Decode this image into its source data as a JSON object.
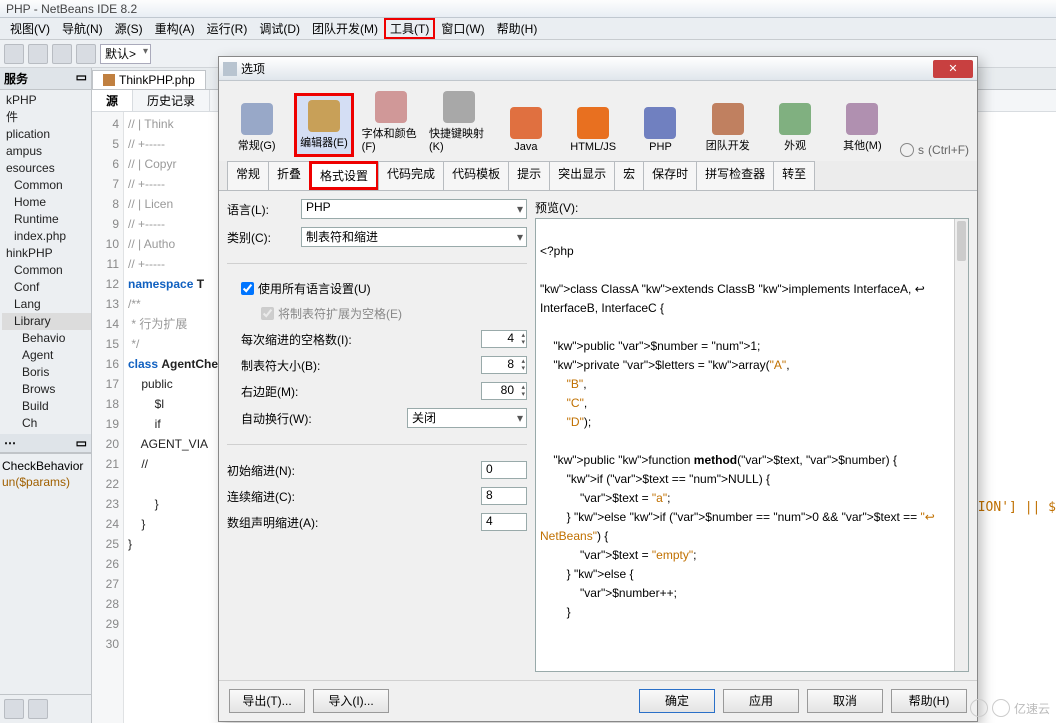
{
  "window": {
    "title": "PHP - NetBeans IDE 8.2"
  },
  "menu": [
    "视图(V)",
    "导航(N)",
    "源(S)",
    "重构(A)",
    "运行(R)",
    "调试(D)",
    "团队开发(M)",
    "工具(T)",
    "窗口(W)",
    "帮助(H)"
  ],
  "toolbar": {
    "combo": "默认>"
  },
  "services_panel": {
    "title": "服务"
  },
  "project_tree": [
    {
      "l": 1,
      "t": "kPHP"
    },
    {
      "l": 1,
      "t": "件"
    },
    {
      "l": 1,
      "t": "plication"
    },
    {
      "l": 1,
      "t": "ampus"
    },
    {
      "l": 1,
      "t": "esources"
    },
    {
      "l": 2,
      "t": "Common"
    },
    {
      "l": 2,
      "t": "Home"
    },
    {
      "l": 2,
      "t": "Runtime"
    },
    {
      "l": 2,
      "t": "index.php"
    },
    {
      "l": 1,
      "t": "hinkPHP"
    },
    {
      "l": 2,
      "t": "Common"
    },
    {
      "l": 2,
      "t": "Conf"
    },
    {
      "l": 2,
      "t": "Lang"
    },
    {
      "l": 2,
      "t": "Library",
      "sel": true
    },
    {
      "l": 3,
      "t": "Behavio"
    },
    {
      "l": 3,
      "t": "Agent"
    },
    {
      "l": 3,
      "t": "Boris"
    },
    {
      "l": 3,
      "t": "Brows"
    },
    {
      "l": 3,
      "t": "Build"
    },
    {
      "l": 3,
      "t": "Ch"
    }
  ],
  "navigator": {
    "item1": "CheckBehavior",
    "item2": "un($params)"
  },
  "editor": {
    "tab": "ThinkPHP.php",
    "sub_source": "源",
    "sub_history": "历史记录",
    "lines_start": 4,
    "lines_end": 30,
    "code_lines": [
      "// | Think",
      "// +-----",
      "// | Copyr",
      "// +-----",
      "// | Licen",
      "// +-----",
      "// | Autho",
      "// +-----",
      "",
      "namespace T",
      "",
      "/**",
      " * 行为扩展",
      " */",
      "class AgentCheckBehavior",
      "",
      "    public",
      "        $l",
      "        if",
      "    AGENT_VIA",
      "    //",
      "    ",
      "        }",
      "    }",
      "",
      "}",
      ""
    ]
  },
  "far_right_text": "TION'] || $",
  "dialog": {
    "title": "选项",
    "close": "✕",
    "search_hint": "(Ctrl+F)",
    "search_icon_text": "s",
    "categories": [
      {
        "id": "general",
        "label": "常规(G)",
        "color": "#98a8c8"
      },
      {
        "id": "editor",
        "label": "编辑器(E)",
        "color": "#c8a058",
        "sel": true,
        "hl": true
      },
      {
        "id": "fonts",
        "label": "字体和颜色(F)",
        "color": "#d09898"
      },
      {
        "id": "keymap",
        "label": "快捷键映射(K)",
        "color": "#a8a8a8"
      },
      {
        "id": "java",
        "label": "Java",
        "color": "#e07040"
      },
      {
        "id": "htmljs",
        "label": "HTML/JS",
        "color": "#e87020"
      },
      {
        "id": "php",
        "label": "PHP",
        "color": "#7080c0"
      },
      {
        "id": "team",
        "label": "团队开发",
        "color": "#c08060"
      },
      {
        "id": "appearance",
        "label": "外观",
        "color": "#80b080"
      },
      {
        "id": "misc",
        "label": "其他(M)",
        "color": "#b090b0"
      }
    ],
    "tabs": [
      "常规",
      "折叠",
      "格式设置",
      "代码完成",
      "代码模板",
      "提示",
      "突出显示",
      "宏",
      "保存时",
      "拼写检查器",
      "转至"
    ],
    "active_tab": "格式设置",
    "fields": {
      "lang_label": "语言(L):",
      "lang": "PHP",
      "cat_label": "类别(C):",
      "cat": "制表符和缩进",
      "use_all_label": "使用所有语言设置(U)",
      "use_all": true,
      "expand_label": "将制表符扩展为空格(E)",
      "expand": true,
      "spaces_label": "每次缩进的空格数(I):",
      "spaces": 4,
      "tab_label": "制表符大小(B):",
      "tab": 8,
      "margin_label": "右边距(M):",
      "margin": 80,
      "wrap_label": "自动换行(W):",
      "wrap": "关闭",
      "init_label": "初始缩进(N):",
      "init": 0,
      "cont_label": "连续缩进(C):",
      "cont": 8,
      "arr_label": "数组声明缩进(A):",
      "arr": 4
    },
    "preview_label": "预览(V):",
    "preview_code": "<?php\n\nclass ClassA extends ClassB implements InterfaceA, ↩\nInterfaceB, InterfaceC {\n\n    public $number = 1;\n    private $letters = array(\"A\",\n        \"B\",\n        \"C\",\n        \"D\");\n\n    public function method($text, $number) {\n        if ($text == NULL) {\n            $text = \"a\";\n        } else if ($number == 0 && $text == \"↩\nNetBeans\") {\n            $text = \"empty\";\n        } else {\n            $number++;\n        }",
    "buttons": {
      "export": "导出(T)...",
      "import": "导入(I)...",
      "ok": "确定",
      "apply": "应用",
      "cancel": "取消",
      "help": "帮助(H)"
    }
  },
  "watermark": "亿速云"
}
